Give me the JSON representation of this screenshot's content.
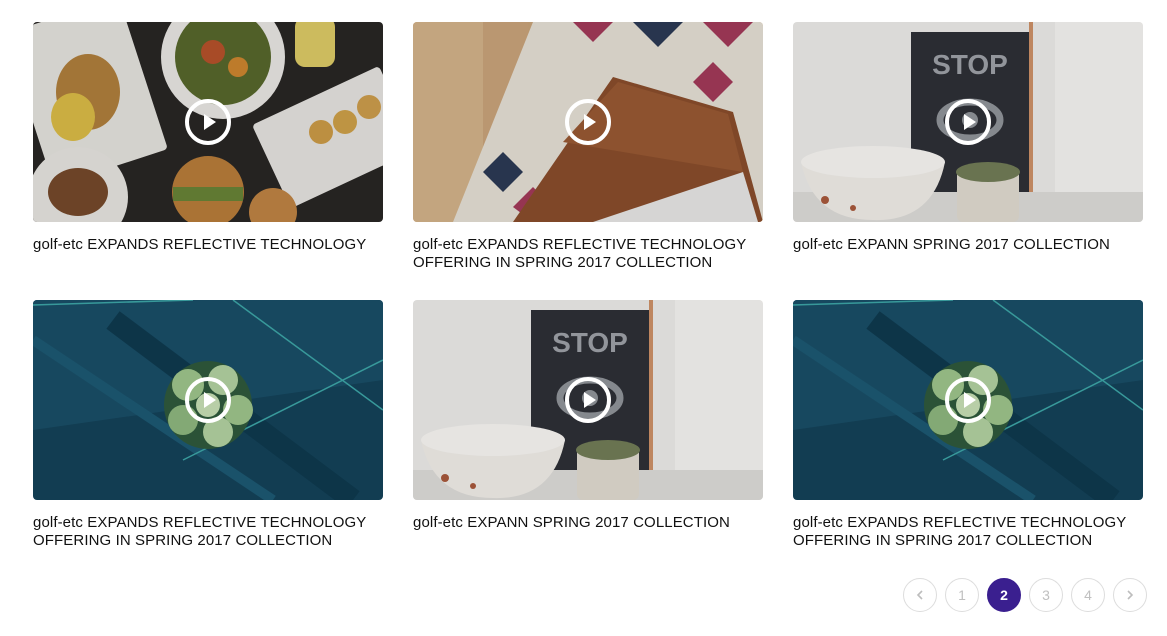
{
  "videos": [
    {
      "brand": "golf-etc",
      "title": " EXPANDS REFLECTIVE TECHNOLOGY",
      "thumb": "food-platter",
      "icon": "play-icon"
    },
    {
      "brand": "golf-etc",
      "title": " EXPANDS REFLECTIVE TECHNOLOGY OFFERING IN SPRING 2017 COLLECTION",
      "thumb": "wood-rug-laptop",
      "icon": "play-icon"
    },
    {
      "brand": "golf-etc",
      "title": " EXPANN SPRING 2017 COLLECTION",
      "thumb": "stop-sign-bowls",
      "icon": "play-icon"
    },
    {
      "brand": "golf-etc",
      "title": " EXPANDS REFLECTIVE TECHNOLOGY OFFERING IN SPRING 2017 COLLECTION",
      "thumb": "denim-flower",
      "icon": "play-icon"
    },
    {
      "brand": "golf-etc",
      "title": " EXPANN SPRING 2017 COLLECTION",
      "thumb": "stop-sign-bowls",
      "icon": "play-icon"
    },
    {
      "brand": "golf-etc",
      "title": " EXPANDS REFLECTIVE TECHNOLOGY OFFERING IN SPRING 2017 COLLECTION",
      "thumb": "denim-flower",
      "icon": "play-icon"
    }
  ],
  "pagination": {
    "prev_icon": "chevron-left-icon",
    "next_icon": "chevron-right-icon",
    "pages": [
      "1",
      "2",
      "3",
      "4"
    ],
    "current": "2",
    "accent": "#3a1f8f"
  }
}
